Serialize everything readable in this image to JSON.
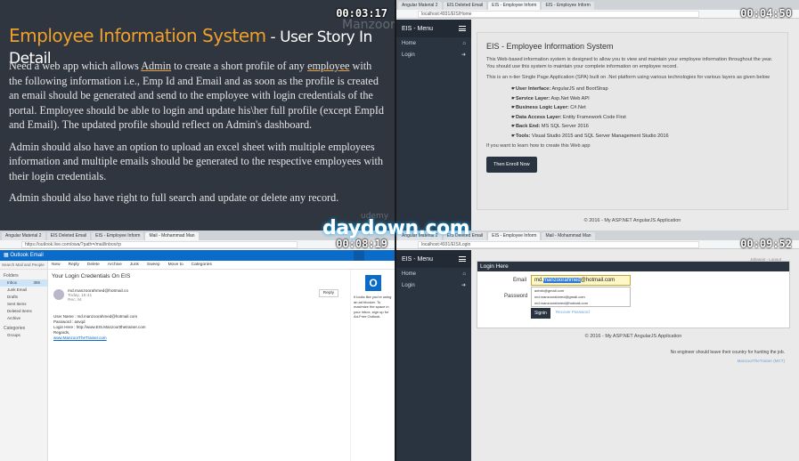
{
  "timers": [
    "00:03:17",
    "00:04:50",
    "00:08:19",
    "00:09:52"
  ],
  "watermark_site": "daydown.com",
  "slide": {
    "title_main": "Employee Information System",
    "title_sub": " - User Story In Detail",
    "para1_a": "Need a web app which allows ",
    "para1_admin": "Admin",
    "para1_b": " to create a short profile of any ",
    "para1_employee": "employee",
    "para1_c": " with the following information i.e., Emp Id and Email and as soon as the profile is created an email should be generated and send to the employee with login credentials of the portal. Employee should be able to login and update his\\her full profile (except EmpId and Email). The updated profile should reflect on Admin's dashboard.",
    "para2": "Admin should also have an option to upload an excel sheet with multiple employees information and multiple emails should be generated to the respective employees with their login credentials.",
    "para3": "Admin should also have right to full search and update or delete any record.",
    "watermark_manzoor": "Manzoor",
    "watermark_udemy": "udemy"
  },
  "eis_home": {
    "tabs": [
      "Angular Material 2",
      "EIS Deleted Email",
      "EIS - Employee Inform",
      "EIS - Employee Inform"
    ],
    "url": "localhost:4931/EIS/Home",
    "menu_title": "EIS - Menu",
    "menu_items": [
      {
        "label": "Home"
      },
      {
        "label": "Login"
      }
    ],
    "heading": "EIS - Employee Information System",
    "intro": "This Web-based information system is designed to allow you to view and maintain your employee information throughout the year. You should use this system to maintain your complete information on employee record.",
    "ntier": "This is an n-tier Single Page Application (SPA) built on .Net platform using various technologies for various layers as given below",
    "tech": [
      {
        "label": "User Interface:",
        "value": " AngularJS and BootStrap"
      },
      {
        "label": "Service Layer:",
        "value": " Asp.Net Web API"
      },
      {
        "label": "Business Logic Layer:",
        "value": " C#.Net"
      },
      {
        "label": "Data Access Layer:",
        "value": " Entity Framework Code First"
      },
      {
        "label": "Back End:",
        "value": " MS SQL Server 2016"
      },
      {
        "label": "Tools:",
        "value": " Visual Studio 2015 and SQL Server Management Studio 2016"
      }
    ],
    "learn": "If you want to learn how to create this Web app",
    "enroll_btn": "Then Enroll Now",
    "footer": "© 2016 - My ASP.NET AngularJS Application"
  },
  "outlook": {
    "tabs": [
      "Angular Material 2",
      "EIS Deleted Email",
      "EIS - Employee Inform",
      "Mail - Mohammad Man"
    ],
    "url": "https://outlook.live.com/owa/?path=/mail/inbox/rp",
    "title": "Outlook Email",
    "search": "Search Mail and People",
    "folders_header": "Folders",
    "folders": [
      {
        "name": "Inbox",
        "count": "365"
      },
      {
        "name": "Junk Email",
        "count": ""
      },
      {
        "name": "Drafts",
        "count": ""
      },
      {
        "name": "Sent Items",
        "count": ""
      },
      {
        "name": "Deleted Items",
        "count": ""
      },
      {
        "name": "Archive",
        "count": ""
      }
    ],
    "categories_header": "Categories",
    "groups_header": "Groups",
    "toolbar": [
      "New",
      "Reply",
      "Delete",
      "Archive",
      "Junk",
      "Sweep",
      "Move to",
      "Categories"
    ],
    "subject": "Your Login Credentials On EIS",
    "from": "md.manzoorahmed@hotmail.co",
    "from_time": "Today, 16:41",
    "from_to": "Rec: M.",
    "reply": "Reply",
    "msg_user": "User Name : md.manzoorahmed@hotmail.com",
    "msg_pass": "Password : asvqd",
    "msg_login": "Login Here : http://www.EIS.Manzoortthetrainer.com",
    "msg_regards": "Regards,",
    "msg_site": "www.ManzoorTheTrainer.com",
    "side_text": "It looks like you're using an ad blocker. To maximize the space in your inbox, sign up for Ad-Free Outlook."
  },
  "login": {
    "tabs": [
      "Angular Material 2",
      "EIS Deleted Email",
      "EIS - Employee Inform",
      "Mail - Mohammad Man"
    ],
    "url": "localhost:4931/EIS/Login",
    "menu_title": "EIS - Menu",
    "menu_items": [
      {
        "label": "Home"
      },
      {
        "label": "Login"
      }
    ],
    "user_chip": "Jahangir - Logout",
    "box_title": "Login Here",
    "email_label": "Email",
    "email_prefix": "md.",
    "email_highlight": "manzoorahmed",
    "email_suffix": "@hotmail.com",
    "suggestions": [
      "admin@gmail.com",
      "md.manzoorahmed@gmail.com",
      "md.manzoorahmed@hotmail.com"
    ],
    "password_label": "Password",
    "signin_btn": "Signin",
    "forgot": "Recover Password",
    "footer": "© 2016 - My ASP.NET AngularJS Application",
    "quote": "No engineer should leave their country for hunting the job.",
    "quote_by": "ManzoorTheTrainer  (MCT)"
  }
}
